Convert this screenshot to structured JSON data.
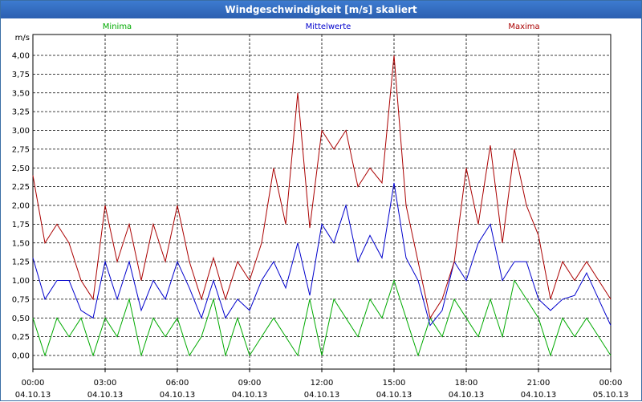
{
  "window": {
    "title": "Windgeschwindigkeit [m/s] skaliert"
  },
  "chart_data": {
    "type": "line",
    "title": "Windgeschwindigkeit [m/s] skaliert",
    "ylabel": "m/s",
    "ylim": [
      0,
      4.25
    ],
    "yticks": [
      "0,00",
      "0,25",
      "0,50",
      "0,75",
      "1,00",
      "1,25",
      "1,50",
      "1,75",
      "2,00",
      "2,25",
      "2,50",
      "2,75",
      "3,00",
      "3,25",
      "3,50",
      "3,75",
      "4,00"
    ],
    "xticks": [
      {
        "time": "00:00",
        "date": "04.10.13"
      },
      {
        "time": "03:00",
        "date": "04.10.13"
      },
      {
        "time": "06:00",
        "date": "04.10.13"
      },
      {
        "time": "09:00",
        "date": "04.10.13"
      },
      {
        "time": "12:00",
        "date": "04.10.13"
      },
      {
        "time": "15:00",
        "date": "04.10.13"
      },
      {
        "time": "18:00",
        "date": "04.10.13"
      },
      {
        "time": "21:00",
        "date": "04.10.13"
      },
      {
        "time": "00:00",
        "date": "05.10.13"
      }
    ],
    "grid": true,
    "x_hours": [
      0,
      0.5,
      1,
      1.5,
      2,
      2.5,
      3,
      3.5,
      4,
      4.5,
      5,
      5.5,
      6,
      6.5,
      7,
      7.5,
      8,
      8.5,
      9,
      9.5,
      10,
      10.5,
      11,
      11.5,
      12,
      12.5,
      13,
      13.5,
      14,
      14.5,
      15,
      15.5,
      16,
      16.5,
      17,
      17.5,
      18,
      18.5,
      19,
      19.5,
      20,
      20.5,
      21,
      21.5,
      22,
      22.5,
      23,
      23.5,
      24
    ],
    "series": [
      {
        "name": "Minima",
        "color": "#00aa00",
        "values": [
          0.5,
          0.0,
          0.5,
          0.25,
          0.5,
          0.0,
          0.5,
          0.25,
          0.75,
          0.0,
          0.5,
          0.25,
          0.5,
          0.0,
          0.25,
          0.75,
          0.0,
          0.5,
          0.0,
          0.25,
          0.5,
          0.25,
          0.0,
          0.75,
          0.0,
          0.75,
          0.5,
          0.25,
          0.75,
          0.5,
          1.0,
          0.5,
          0.0,
          0.5,
          0.25,
          0.75,
          0.5,
          0.25,
          0.75,
          0.25,
          1.0,
          0.75,
          0.5,
          0.0,
          0.5,
          0.25,
          0.5,
          0.25,
          0.0
        ]
      },
      {
        "name": "Mittelwerte",
        "color": "#0000cc",
        "values": [
          1.3,
          0.75,
          1.0,
          1.0,
          0.6,
          0.5,
          1.25,
          0.75,
          1.25,
          0.6,
          1.0,
          0.75,
          1.25,
          0.9,
          0.5,
          1.0,
          0.5,
          0.75,
          0.6,
          1.0,
          1.25,
          0.9,
          1.5,
          0.8,
          1.75,
          1.5,
          2.0,
          1.25,
          1.6,
          1.3,
          2.3,
          1.3,
          1.0,
          0.4,
          0.6,
          1.25,
          1.0,
          1.5,
          1.75,
          1.0,
          1.25,
          1.25,
          0.75,
          0.6,
          0.75,
          0.8,
          1.1,
          0.75,
          0.4
        ]
      },
      {
        "name": "Maxima",
        "color": "#aa0000",
        "values": [
          2.4,
          1.5,
          1.75,
          1.5,
          1.0,
          0.75,
          2.0,
          1.25,
          1.75,
          1.0,
          1.75,
          1.25,
          2.0,
          1.25,
          0.75,
          1.3,
          0.75,
          1.25,
          1.0,
          1.5,
          2.5,
          1.75,
          3.5,
          1.7,
          3.0,
          2.75,
          3.0,
          2.25,
          2.5,
          2.3,
          4.0,
          2.0,
          1.25,
          0.5,
          0.75,
          1.25,
          2.5,
          1.75,
          2.8,
          1.5,
          2.75,
          2.0,
          1.6,
          0.75,
          1.25,
          1.0,
          1.25,
          1.0,
          0.75
        ]
      }
    ]
  }
}
